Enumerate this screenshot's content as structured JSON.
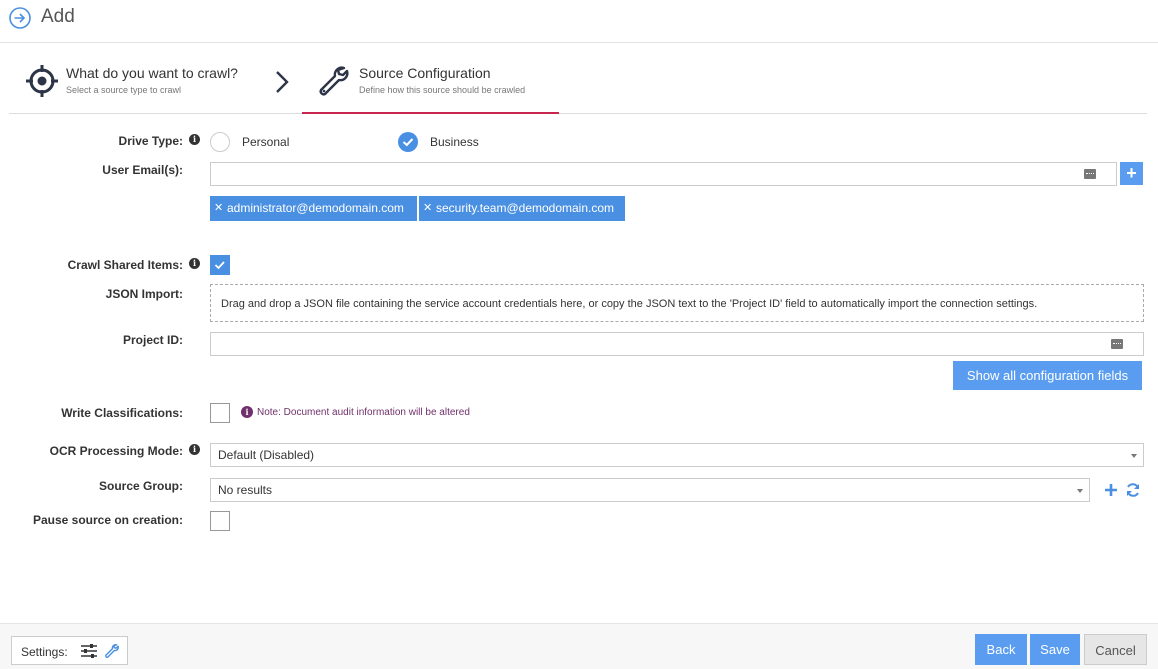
{
  "header": {
    "title": "Add"
  },
  "steps": [
    {
      "title": "What do you want to crawl?",
      "subtitle": "Select a source type to crawl"
    },
    {
      "title": "Source Configuration",
      "subtitle": "Define how this source should be crawled"
    }
  ],
  "form": {
    "drive_type": {
      "label": "Drive Type:",
      "options": [
        "Personal",
        "Business"
      ],
      "selected": "Business"
    },
    "user_emails": {
      "label": "User Email(s):",
      "value": "",
      "tags": [
        "administrator@demodomain.com",
        "security.team@demodomain.com"
      ]
    },
    "crawl_shared": {
      "label": "Crawl Shared Items:",
      "checked": true
    },
    "json_import": {
      "label": "JSON Import:",
      "text": "Drag and drop a JSON file containing the service account credentials here, or copy the JSON text to the 'Project ID' field to automatically import the connection settings."
    },
    "project_id": {
      "label": "Project ID:",
      "value": ""
    },
    "show_all_button": "Show all configuration fields",
    "write_classifications": {
      "label": "Write Classifications:",
      "checked": false,
      "note": "Note: Document audit information will be altered"
    },
    "ocr_mode": {
      "label": "OCR Processing Mode:",
      "value": "Default (Disabled)"
    },
    "source_group": {
      "label": "Source Group:",
      "value": "No results"
    },
    "pause_source": {
      "label": "Pause source on creation:",
      "checked": false
    }
  },
  "footer": {
    "settings_label": "Settings:",
    "back": "Back",
    "save": "Save",
    "cancel": "Cancel"
  },
  "colors": {
    "accent": "#4a90e2",
    "step_underline": "#c8264f",
    "note": "#70306b"
  }
}
